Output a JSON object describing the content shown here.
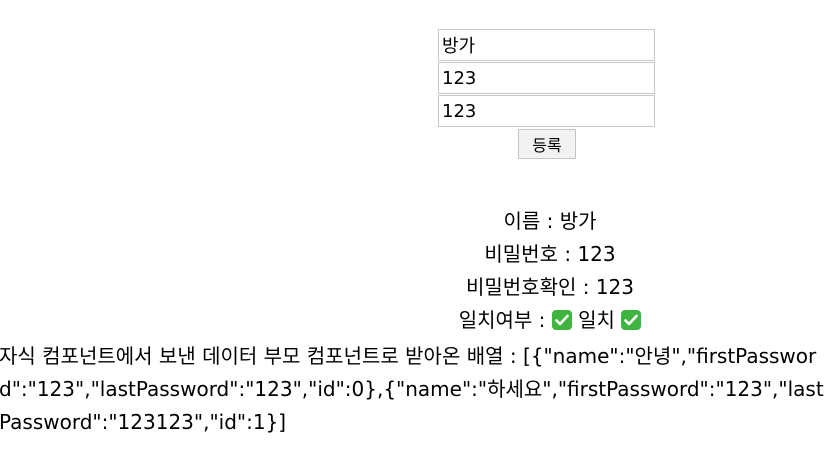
{
  "form": {
    "name_value": "방가",
    "first_password_value": "123",
    "last_password_value": "123",
    "submit_label": "등록"
  },
  "results": {
    "name_label": "이름 : ",
    "name_value": "방가",
    "password_label": "비밀번호 : ",
    "password_value": "123",
    "confirm_label": "비밀번호확인 : ",
    "confirm_value": "123",
    "match_label": "일치여부 : ",
    "match_text": " 일치 ",
    "match_icon": "check-mark-icon",
    "match_icon_color": "#3fb43f"
  },
  "summary": {
    "text": "자식 컴포넌트에서 보낸 데이터 부모 컴포넌트로 받아온 배열 : [{\"name\":\"안녕\",\"firstPassword\":\"123\",\"lastPassword\":\"123\",\"id\":0},{\"name\":\"하세요\",\"firstPassword\":\"123\",\"lastPassword\":\"123123\",\"id\":1}]"
  }
}
